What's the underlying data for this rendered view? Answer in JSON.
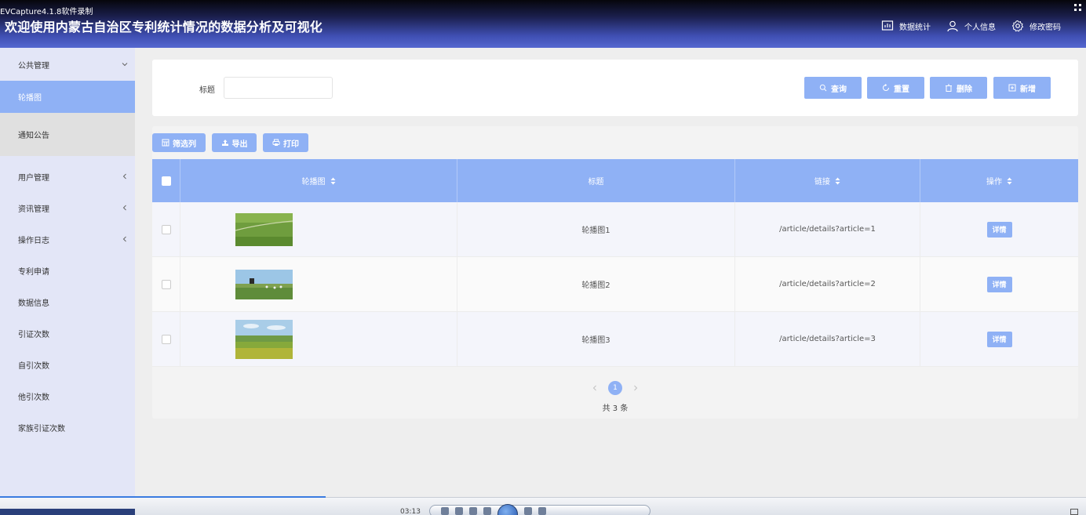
{
  "recorder": {
    "label": "EVCapture4.1.8软件录制"
  },
  "header": {
    "title": "欢迎使用内蒙古自治区专利统计情况的数据分析及可视化",
    "nav": [
      {
        "label": "数据统计",
        "icon": "chart-icon"
      },
      {
        "label": "个人信息",
        "icon": "user-icon"
      },
      {
        "label": "修改密码",
        "icon": "gear-icon"
      }
    ]
  },
  "sidebar": {
    "items": [
      {
        "label": "公共管理",
        "chevron": "down"
      },
      {
        "label": "轮播图",
        "active": true
      },
      {
        "label": "通知公告"
      },
      {
        "label": "用户管理",
        "chevron": "left"
      },
      {
        "label": "资讯管理",
        "chevron": "left"
      },
      {
        "label": "操作日志",
        "chevron": "left"
      },
      {
        "label": "专利申请"
      },
      {
        "label": "数据信息"
      },
      {
        "label": "引证次数"
      },
      {
        "label": "自引次数"
      },
      {
        "label": "他引次数"
      },
      {
        "label": "家族引证次数"
      }
    ]
  },
  "search": {
    "label": "标题",
    "value": "",
    "buttons": {
      "query": "查询",
      "reset": "重置",
      "delete": "删除",
      "add": "新增"
    }
  },
  "toolbar": {
    "filter": "筛选列",
    "export": "导出",
    "print": "打印"
  },
  "table": {
    "columns": [
      "轮播图",
      "标题",
      "链接",
      "操作"
    ],
    "rows": [
      {
        "title": "轮播图1",
        "link": "/article/details?article=1",
        "action": "详情"
      },
      {
        "title": "轮播图2",
        "link": "/article/details?article=2",
        "action": "详情"
      },
      {
        "title": "轮播图3",
        "link": "/article/details?article=3",
        "action": "详情"
      }
    ]
  },
  "pagination": {
    "current": "1",
    "total_text": "共 3 条"
  },
  "player": {
    "time": "03:13",
    "progress": 0.3
  },
  "colors": {
    "accent": "#8fb1f5",
    "header_top": "#06060c",
    "header_bottom": "#5567d0",
    "sidebar_bg": "#e3e6f7"
  }
}
